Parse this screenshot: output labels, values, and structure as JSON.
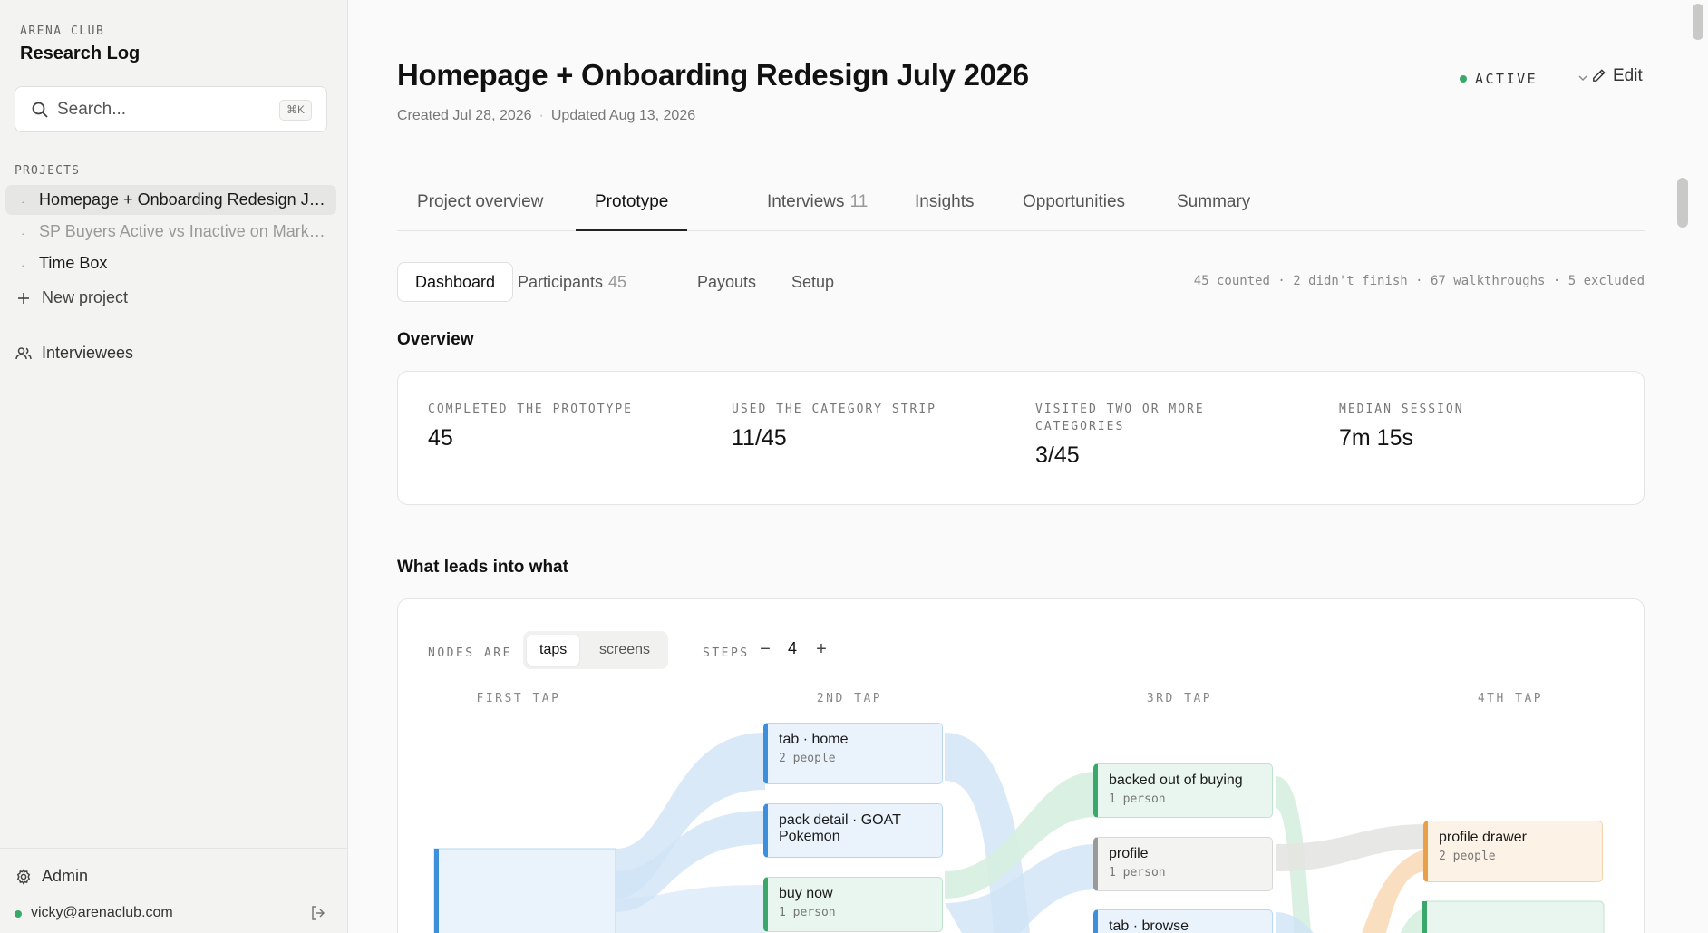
{
  "sidebar": {
    "org": "ARENA CLUB",
    "app_title": "Research Log",
    "search": {
      "placeholder": "Search...",
      "shortcut": "⌘K"
    },
    "section_label": "PROJECTS",
    "projects": [
      {
        "label": "Homepage + Onboarding Redesign July 2026",
        "selected": true
      },
      {
        "label": "SP Buyers Active vs Inactive on Marketplace",
        "muted": true
      },
      {
        "label": "Time Box"
      }
    ],
    "new_project_label": "New project",
    "interviewees_label": "Interviewees",
    "admin_label": "Admin",
    "user_email": "vicky@arenaclub.com"
  },
  "header": {
    "title": "Homepage + Onboarding Redesign July 2026",
    "created": "Created Jul 28, 2026",
    "updated": "Updated Aug 13, 2026",
    "status": "ACTIVE",
    "edit_label": "Edit"
  },
  "tabs": [
    {
      "label": "Project overview"
    },
    {
      "label": "Prototype",
      "active": true
    },
    {
      "label": "Interviews",
      "count": "11"
    },
    {
      "label": "Insights"
    },
    {
      "label": "Opportunities"
    },
    {
      "label": "Summary"
    }
  ],
  "subtabs": [
    {
      "label": "Dashboard",
      "active": true
    },
    {
      "label": "Participants",
      "count": "45"
    },
    {
      "label": "Payouts"
    },
    {
      "label": "Setup"
    }
  ],
  "counts_summary": "45 counted · 2 didn't finish · 67 walkthroughs · 5 excluded",
  "overview": {
    "heading": "Overview",
    "stats": [
      {
        "label": "COMPLETED THE PROTOTYPE",
        "value": "45"
      },
      {
        "label": "USED THE CATEGORY STRIP",
        "value": "11/45"
      },
      {
        "label": "VISITED TWO OR MORE CATEGORIES",
        "value": "3/45"
      },
      {
        "label": "MEDIAN SESSION",
        "value": "7m 15s"
      }
    ]
  },
  "flow": {
    "heading": "What leads into what",
    "nodes_are_label": "NODES ARE",
    "node_modes": [
      "taps",
      "screens"
    ],
    "selected_mode": "taps",
    "steps_label": "STEPS",
    "steps_value": "4",
    "decrement": "−",
    "increment": "+",
    "columns": [
      "FIRST TAP",
      "2ND TAP",
      "3RD TAP",
      "4TH TAP"
    ],
    "nodes": [
      {
        "label": "tab · home",
        "count": "2 people",
        "color": "blue"
      },
      {
        "label": "pack detail · GOAT Pokemon",
        "count": "",
        "color": "blue"
      },
      {
        "label": "buy now",
        "count": "1 person",
        "color": "green"
      },
      {
        "label": "backed out of buying",
        "count": "1 person",
        "color": "green"
      },
      {
        "label": "profile",
        "count": "1 person",
        "color": "gray"
      },
      {
        "label": "tab · browse",
        "count": "",
        "color": "blue"
      },
      {
        "label": "profile drawer",
        "count": "2 people",
        "color": "orange"
      }
    ],
    "colors": {
      "blue": "#3d8fd9",
      "green": "#3aa86b",
      "gray": "#9a9a98",
      "orange": "#e8a14a"
    }
  }
}
